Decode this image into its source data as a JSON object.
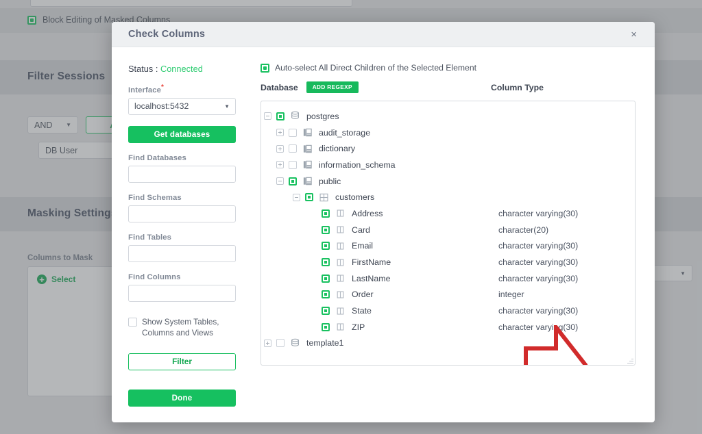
{
  "background": {
    "block_editing_label": "Block Editing of Masked Columns",
    "filter_sessions_title": "Filter Sessions",
    "masking_settings_title": "Masking Settings",
    "and_select": "AND",
    "add_button": "Add",
    "db_user_input": "DB User",
    "columns_to_mask_label": "Columns to Mask",
    "select_label": "Select"
  },
  "modal": {
    "title": "Check Columns",
    "close_label": "×",
    "left": {
      "status_prefix": "Status : ",
      "status_value": "Connected",
      "interface_label": "Interface",
      "interface_value": "localhost:5432",
      "get_databases_button": "Get databases",
      "find_databases_label": "Find Databases",
      "find_databases_value": "",
      "find_schemas_label": "Find Schemas",
      "find_schemas_value": "",
      "find_tables_label": "Find Tables",
      "find_tables_value": "",
      "find_columns_label": "Find Columns",
      "find_columns_value": "",
      "show_system_label": "Show System Tables, Columns and Views",
      "filter_button": "Filter",
      "done_button": "Done"
    },
    "right": {
      "autoselect_label": "Auto-select All Direct Children of the Selected Element",
      "database_label": "Database",
      "add_regexp_button": "ADD REGEXP",
      "column_type_label": "Column Type",
      "tree": [
        {
          "label": "postgres",
          "depth": 0,
          "icon": "database-icon",
          "expander": "minus",
          "checked": true,
          "type": ""
        },
        {
          "label": "audit_storage",
          "depth": 1,
          "icon": "schema-icon",
          "expander": "plus",
          "checked": false,
          "type": ""
        },
        {
          "label": "dictionary",
          "depth": 1,
          "icon": "schema-icon",
          "expander": "plus",
          "checked": false,
          "type": ""
        },
        {
          "label": "information_schema",
          "depth": 1,
          "icon": "schema-icon",
          "expander": "plus",
          "checked": false,
          "type": ""
        },
        {
          "label": "public",
          "depth": 1,
          "icon": "schema-icon",
          "expander": "minus",
          "checked": true,
          "type": ""
        },
        {
          "label": "customers",
          "depth": 2,
          "icon": "table-icon",
          "expander": "minus",
          "checked": true,
          "type": ""
        },
        {
          "label": "Address",
          "depth": 3,
          "icon": "column-icon",
          "expander": "none",
          "checked": true,
          "type": "character varying(30)"
        },
        {
          "label": "Card",
          "depth": 3,
          "icon": "column-icon",
          "expander": "none",
          "checked": true,
          "type": "character(20)"
        },
        {
          "label": "Email",
          "depth": 3,
          "icon": "column-icon",
          "expander": "none",
          "checked": true,
          "type": "character varying(30)"
        },
        {
          "label": "FirstName",
          "depth": 3,
          "icon": "column-icon",
          "expander": "none",
          "checked": true,
          "type": "character varying(30)"
        },
        {
          "label": "LastName",
          "depth": 3,
          "icon": "column-icon",
          "expander": "none",
          "checked": true,
          "type": "character varying(30)"
        },
        {
          "label": "Order",
          "depth": 3,
          "icon": "column-icon",
          "expander": "none",
          "checked": true,
          "type": "integer"
        },
        {
          "label": "State",
          "depth": 3,
          "icon": "column-icon",
          "expander": "none",
          "checked": true,
          "type": "character varying(30)"
        },
        {
          "label": "ZIP",
          "depth": 3,
          "icon": "column-icon",
          "expander": "none",
          "checked": true,
          "type": "character varying(30)"
        },
        {
          "label": "template1",
          "depth": 0,
          "icon": "database-icon",
          "expander": "plus",
          "checked": false,
          "type": ""
        }
      ]
    }
  },
  "colors": {
    "accent_green": "#16c060",
    "annotation_red": "#d12b2b",
    "header_bg": "#eef0f2",
    "title_text": "#5c6478"
  }
}
